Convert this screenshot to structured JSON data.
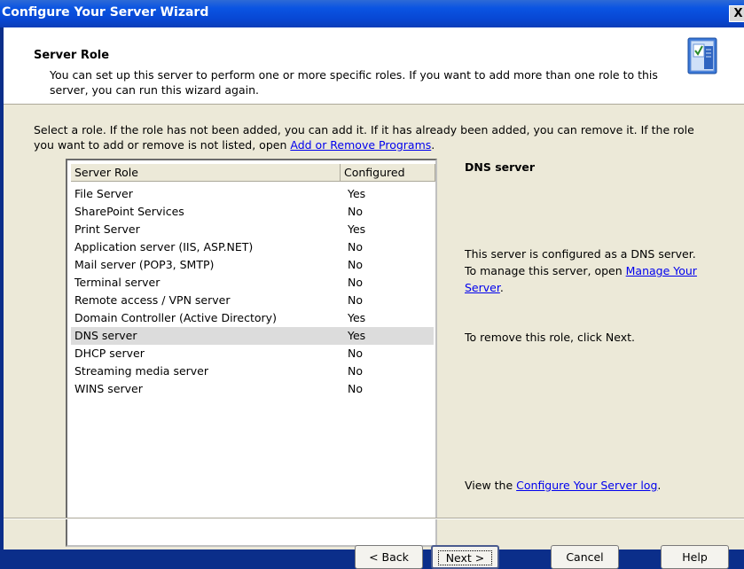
{
  "window": {
    "title": "Configure Your Server Wizard",
    "close_glyph": "X"
  },
  "header": {
    "title": "Server Role",
    "subtitle": "You can set up this server to perform one or more specific roles. If you want to add more than one role to this server, you can run this wizard again.",
    "icon": "server-checklist-icon"
  },
  "instructions": {
    "text": "Select a role. If the role has not been added, you can add it. If it has already been added, you can remove it. If the role you want to add or remove is not listed, open",
    "link": "Add or Remove Programs",
    "end": "."
  },
  "list": {
    "columns": [
      "Server Role",
      "Configured"
    ],
    "rows": [
      {
        "role": "File Server",
        "configured": "Yes"
      },
      {
        "role": "SharePoint Services",
        "configured": "No"
      },
      {
        "role": "Print Server",
        "configured": "Yes"
      },
      {
        "role": "Application server (IIS, ASP.NET)",
        "configured": "No"
      },
      {
        "role": "Mail server (POP3, SMTP)",
        "configured": "No"
      },
      {
        "role": "Terminal server",
        "configured": "No"
      },
      {
        "role": "Remote access / VPN server",
        "configured": "No"
      },
      {
        "role": "Domain Controller (Active Directory)",
        "configured": "Yes"
      },
      {
        "role": "DNS server",
        "configured": "Yes"
      },
      {
        "role": "DHCP server",
        "configured": "No"
      },
      {
        "role": "Streaming media server",
        "configured": "No"
      },
      {
        "role": "WINS server",
        "configured": "No"
      }
    ],
    "selected_index": 8
  },
  "details": {
    "title": "DNS server",
    "configured_text": "This server is configured as a DNS server.",
    "manage_prefix": "To manage this server, open",
    "manage_link": "Manage Your Server",
    "manage_suffix": ".",
    "remove_text": "To remove this role, click Next.",
    "log_prefix": "View the",
    "log_link": "Configure Your Server log",
    "log_suffix": "."
  },
  "buttons": {
    "back": "< Back",
    "next": "Next >",
    "cancel": "Cancel",
    "help": "Help"
  },
  "colors": {
    "title_bar": "#0a54e2",
    "dialog_bg": "#ece9d8",
    "selection": "#dcdcdc",
    "link": "#0000ee"
  }
}
